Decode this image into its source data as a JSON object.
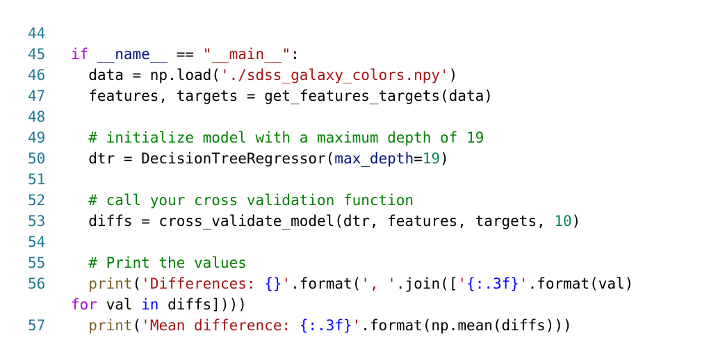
{
  "colors": {
    "background": "#ffffff",
    "line_number": "#237893",
    "default": "#000000",
    "keyword_control": "#af00db",
    "keyword": "#0000ff",
    "variable": "#001080",
    "string": "#a31515",
    "number": "#098658",
    "comment": "#008000",
    "function": "#795e26",
    "format_placeholder": "#0000ff"
  },
  "editor": {
    "lines": [
      {
        "number": "44",
        "tokens": []
      },
      {
        "number": "45",
        "tokens": [
          {
            "text": "if",
            "type": "keyword_control"
          },
          {
            "text": " ",
            "type": "default"
          },
          {
            "text": "__name__",
            "type": "variable"
          },
          {
            "text": " == ",
            "type": "default"
          },
          {
            "text": "\"__main__\"",
            "type": "string"
          },
          {
            "text": ":",
            "type": "default"
          }
        ]
      },
      {
        "number": "46",
        "tokens": [
          {
            "text": "  data = np.load(",
            "type": "default"
          },
          {
            "text": "'./sdss_galaxy_colors.npy'",
            "type": "string"
          },
          {
            "text": ")",
            "type": "default"
          }
        ]
      },
      {
        "number": "47",
        "tokens": [
          {
            "text": "  features, targets = get_features_targets(data)",
            "type": "default"
          }
        ]
      },
      {
        "number": "48",
        "tokens": []
      },
      {
        "number": "49",
        "tokens": [
          {
            "text": "  # initialize model with a maximum depth of 19",
            "type": "comment"
          }
        ]
      },
      {
        "number": "50",
        "tokens": [
          {
            "text": "  dtr = DecisionTreeRegressor(",
            "type": "default"
          },
          {
            "text": "max_depth",
            "type": "variable"
          },
          {
            "text": "=",
            "type": "default"
          },
          {
            "text": "19",
            "type": "number"
          },
          {
            "text": ")",
            "type": "default"
          }
        ]
      },
      {
        "number": "51",
        "tokens": []
      },
      {
        "number": "52",
        "tokens": [
          {
            "text": "  # call your cross validation function",
            "type": "comment"
          }
        ]
      },
      {
        "number": "53",
        "tokens": [
          {
            "text": "  diffs = cross_validate_model(dtr, features, targets, ",
            "type": "default"
          },
          {
            "text": "10",
            "type": "number"
          },
          {
            "text": ")",
            "type": "default"
          }
        ]
      },
      {
        "number": "54",
        "tokens": []
      },
      {
        "number": "55",
        "tokens": [
          {
            "text": "  # Print the values",
            "type": "comment"
          }
        ]
      },
      {
        "number": "56",
        "tokens": [
          {
            "text": "  ",
            "type": "default"
          },
          {
            "text": "print",
            "type": "function"
          },
          {
            "text": "(",
            "type": "default"
          },
          {
            "text": "'Differences: ",
            "type": "string"
          },
          {
            "text": "{}",
            "type": "format_placeholder"
          },
          {
            "text": "'",
            "type": "string"
          },
          {
            "text": ".format(",
            "type": "default"
          },
          {
            "text": "', '",
            "type": "string"
          },
          {
            "text": ".join([",
            "type": "default"
          },
          {
            "text": "'",
            "type": "string"
          },
          {
            "text": "{:.3f}",
            "type": "format_placeholder"
          },
          {
            "text": "'",
            "type": "string"
          },
          {
            "text": ".format(val)",
            "type": "default"
          }
        ]
      },
      {
        "number": "",
        "tokens": [
          {
            "text": "for",
            "type": "keyword_control"
          },
          {
            "text": " val ",
            "type": "default"
          },
          {
            "text": "in",
            "type": "keyword"
          },
          {
            "text": " diffs])))",
            "type": "default"
          }
        ]
      },
      {
        "number": "57",
        "tokens": [
          {
            "text": "  ",
            "type": "default"
          },
          {
            "text": "print",
            "type": "function"
          },
          {
            "text": "(",
            "type": "default"
          },
          {
            "text": "'Mean difference: ",
            "type": "string"
          },
          {
            "text": "{:.3f}",
            "type": "format_placeholder"
          },
          {
            "text": "'",
            "type": "string"
          },
          {
            "text": ".format(np.mean(diffs)))",
            "type": "default"
          }
        ]
      }
    ]
  }
}
